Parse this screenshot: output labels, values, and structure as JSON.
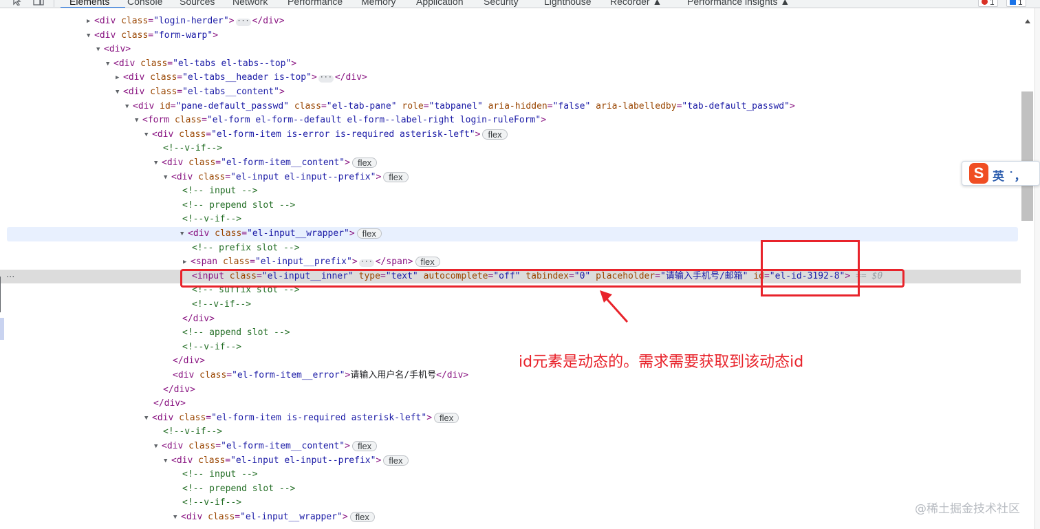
{
  "devtools": {
    "tabs": [
      {
        "label": "Elements"
      },
      {
        "label": "Console"
      },
      {
        "label": "Sources"
      },
      {
        "label": "Network"
      },
      {
        "label": "Performance"
      },
      {
        "label": "Memory"
      },
      {
        "label": "Application"
      },
      {
        "label": "Security"
      },
      {
        "label": "Lighthouse"
      },
      {
        "label": "Recorder ▲"
      },
      {
        "label": "Performance insights ▲"
      }
    ],
    "error_count": "1",
    "issue_count": "1"
  },
  "tree": {
    "r1": {
      "open": "<div ",
      "a1": "class",
      "eq": "=",
      "v1": "\"login-herder\"",
      "gt": ">",
      "close": "</div>"
    },
    "r2": {
      "open": "<div ",
      "a1": "class",
      "v1": "\"form-warp\"",
      "gt": ">"
    },
    "r3": {
      "open": "<div>"
    },
    "r4": {
      "open": "<div ",
      "a1": "class",
      "v1": "\"el-tabs el-tabs--top\"",
      "gt": ">"
    },
    "r5": {
      "open": "<div ",
      "a1": "class",
      "v1": "\"el-tabs__header is-top\"",
      "gt": ">",
      "close": "</div>"
    },
    "r6": {
      "open": "<div ",
      "a1": "class",
      "v1": "\"el-tabs__content\"",
      "gt": ">"
    },
    "r7": {
      "open": "<div ",
      "a1": "id",
      "v1": "\"pane-default_passwd\"",
      "a2": "class",
      "v2": "\"el-tab-pane\"",
      "a3": "role",
      "v3": "\"tabpanel\"",
      "a4": "aria-hidden",
      "v4": "\"false\"",
      "a5": "aria-labelledby",
      "v5": "\"tab-default_passwd\"",
      "gt": ">"
    },
    "r8": {
      "open": "<form ",
      "a1": "class",
      "v1": "\"el-form el-form--default el-form--label-right login-ruleForm\"",
      "gt": ">"
    },
    "r9": {
      "open": "<div ",
      "a1": "class",
      "v1": "\"el-form-item is-error is-required asterisk-left\"",
      "gt": ">",
      "badge": "flex"
    },
    "r10": {
      "comment": "<!--v-if-->"
    },
    "r11": {
      "open": "<div ",
      "a1": "class",
      "v1": "\"el-form-item__content\"",
      "gt": ">",
      "badge": "flex"
    },
    "r12": {
      "open": "<div ",
      "a1": "class",
      "v1": "\"el-input el-input--prefix\"",
      "gt": ">",
      "badge": "flex"
    },
    "r13": {
      "comment": "<!-- input -->"
    },
    "r14": {
      "comment": "<!-- prepend slot -->"
    },
    "r15": {
      "comment": "<!--v-if-->"
    },
    "r16": {
      "open": "<div ",
      "a1": "class",
      "v1": "\"el-input__wrapper\"",
      "gt": ">",
      "badge": "flex"
    },
    "r17": {
      "comment": "<!-- prefix slot -->"
    },
    "r18": {
      "open": "<span ",
      "a1": "class",
      "v1": "\"el-input__prefix\"",
      "gt": ">",
      "close": "</span>",
      "badge": "flex"
    },
    "r19": {
      "open": "<input ",
      "a1": "class",
      "v1": "\"el-input__inner\"",
      "a2": "type",
      "v2": "\"text\"",
      "a3": "autocomplete",
      "v3": "\"off\"",
      "a4": "tabindex",
      "v4": "\"0\"",
      "a5": "placeholder",
      "v5": "\"请输入手机号/邮箱\"",
      "a6": "id",
      "v6": "\"el-id-3192-8\"",
      "gt": ">",
      "eqmark": " == $0"
    },
    "r20": {
      "comment": "<!-- suffix slot -->"
    },
    "r21": {
      "comment": "<!--v-if-->"
    },
    "r22": {
      "close": "</div>"
    },
    "r23": {
      "comment": "<!-- append slot -->"
    },
    "r24": {
      "comment": "<!--v-if-->"
    },
    "r25": {
      "close": "</div>"
    },
    "r26": {
      "open": "<div ",
      "a1": "class",
      "v1": "\"el-form-item__error\"",
      "gt": ">",
      "text": "请输入用户名/手机号",
      "close": "</div>"
    },
    "r27": {
      "close": "</div>"
    },
    "r28": {
      "close": "</div>"
    },
    "r29": {
      "open": "<div ",
      "a1": "class",
      "v1": "\"el-form-item is-required asterisk-left\"",
      "gt": ">",
      "badge": "flex"
    },
    "r30": {
      "comment": "<!--v-if-->"
    },
    "r31": {
      "open": "<div ",
      "a1": "class",
      "v1": "\"el-form-item__content\"",
      "gt": ">",
      "badge": "flex"
    },
    "r32": {
      "open": "<div ",
      "a1": "class",
      "v1": "\"el-input el-input--prefix\"",
      "gt": ">",
      "badge": "flex"
    },
    "r33": {
      "comment": "<!-- input -->"
    },
    "r34": {
      "comment": "<!-- prepend slot -->"
    },
    "r35": {
      "comment": "<!--v-if-->"
    },
    "r36": {
      "open": "<div ",
      "a1": "class",
      "v1": "\"el-input__wrapper\"",
      "gt": ">",
      "badge": "flex"
    }
  },
  "gutter_dots": "...",
  "ime": {
    "logo": "S",
    "text": "英 ˙，"
  },
  "annotation": {
    "note": "id元素是动态的。需求需要获取到该动态id",
    "highlight_color": "#e8232b"
  },
  "watermark": "@稀土掘金技术社区",
  "colors": {
    "tag": "#881280",
    "attr_name": "#994500",
    "attr_value": "#1a1aa6",
    "comment": "#236e25",
    "selected_row": "#dcdcdc",
    "hover_row": "#e8f0fe"
  }
}
